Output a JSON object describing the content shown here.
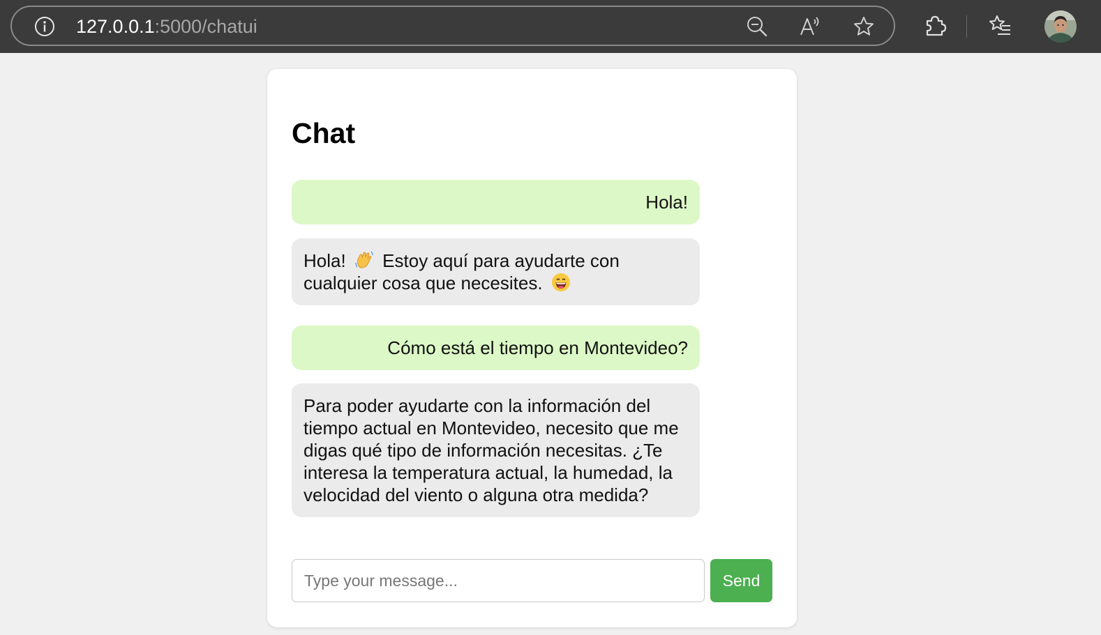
{
  "browser": {
    "url_host": "127.0.0.1",
    "url_rest": ":5000/chatui",
    "icons": {
      "info": "info-icon",
      "zoom": "zoom-out-icon",
      "read_aloud": "read-aloud-icon",
      "favorite": "star-icon",
      "extensions": "puzzle-icon",
      "favorites": "favorites-list-icon",
      "profile": "avatar"
    }
  },
  "chat": {
    "title": "Chat",
    "messages": [
      {
        "role": "user",
        "text": "Hola!"
      },
      {
        "role": "bot",
        "part1": "Hola!",
        "part2": "Estoy aquí para ayudarte con cualquier cosa que necesites.",
        "emojis": [
          "waving-hand-emoji",
          "grinning-face-emoji"
        ]
      },
      {
        "role": "user",
        "text": "Cómo está el tiempo en Montevideo?"
      },
      {
        "role": "bot",
        "text": "Para poder ayudarte con la información del tiempo actual en Montevideo, necesito que me digas qué tipo de información necesitas. ¿Te interesa la temperatura actual, la humedad, la velocidad del viento o alguna otra medida?"
      }
    ],
    "input_placeholder": "Type your message...",
    "input_value": "",
    "send_label": "Send"
  },
  "colors": {
    "user_bubble": "#dcf8c6",
    "bot_bubble": "#ebebeb",
    "send_button": "#4caf50",
    "page_background": "#f0f0f0",
    "browser_bar": "#3b3b3b"
  }
}
